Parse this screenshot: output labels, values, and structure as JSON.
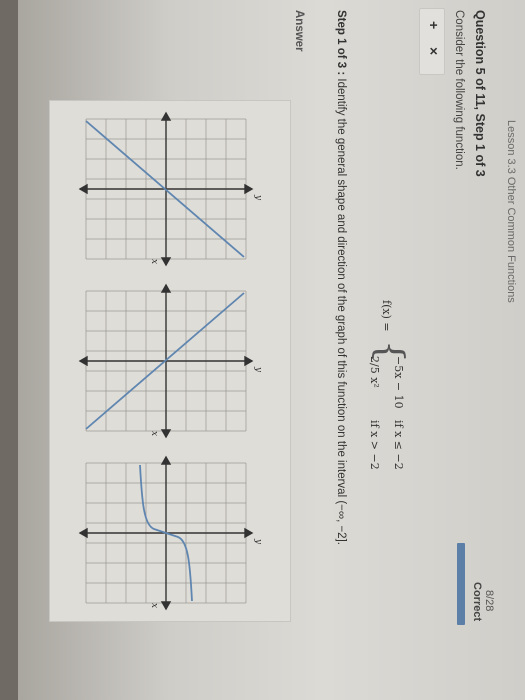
{
  "breadcrumb": "Lesson 3.3 Other Common Functions",
  "question": {
    "header": "Question 5 of 11, Step 1 of 3",
    "score": "8/28",
    "status": "Correct",
    "progress": 0.3
  },
  "prompt": "Consider the following function.",
  "toolbar": {
    "plus_label": "+",
    "times_label": "×"
  },
  "function": {
    "lhs": "f(x) =",
    "piece1": "−5x − 10",
    "cond1": "if x ≤ −2",
    "piece2": "2/5 x²",
    "cond2": "if x > −2"
  },
  "step": {
    "prefix": "Step 1 of 3 :",
    "text": " Identify the general shape and direction of the graph of this function on the interval (−∞, −2]."
  },
  "answer_label": "Answer",
  "choices": [
    {
      "id": "line-increasing",
      "xlabel": "x",
      "ylabel": "y"
    },
    {
      "id": "line-decreasing",
      "xlabel": "x",
      "ylabel": "y"
    },
    {
      "id": "cube-root",
      "xlabel": "x",
      "ylabel": "y"
    }
  ]
}
